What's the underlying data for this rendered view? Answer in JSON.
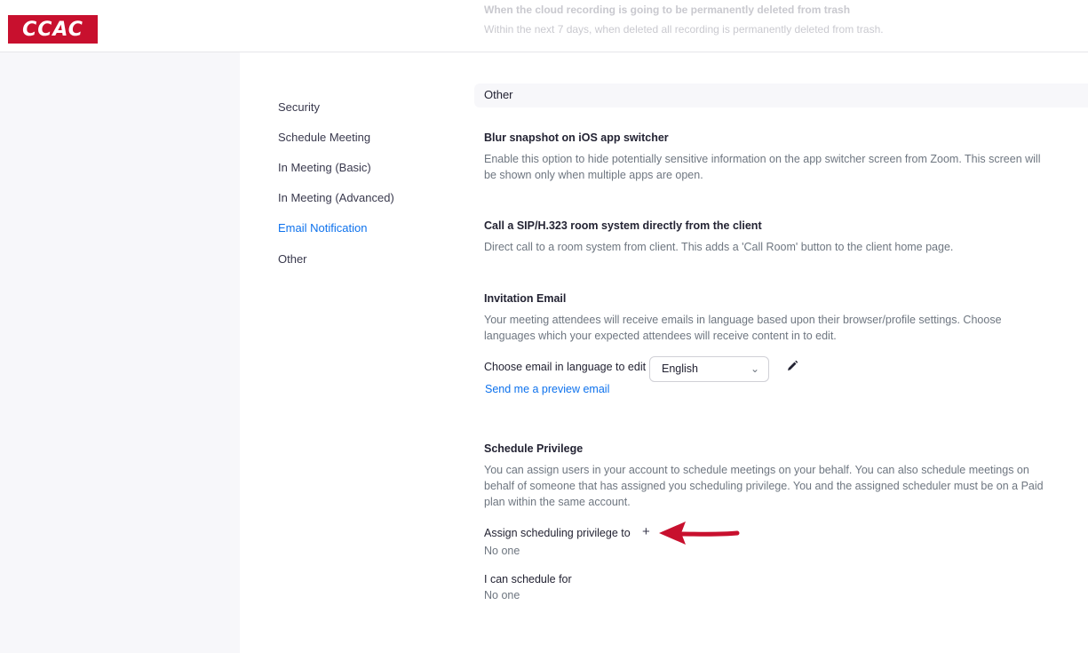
{
  "header": {
    "logo_text": "CCAC",
    "faded_title": "When the cloud recording is going to be permanently deleted from trash",
    "faded_desc": "Within the next 7 days, when deleted all recording is permanently deleted from trash."
  },
  "nav": {
    "items": [
      {
        "label": "Security",
        "active": false
      },
      {
        "label": "Schedule Meeting",
        "active": false
      },
      {
        "label": "In Meeting (Basic)",
        "active": false
      },
      {
        "label": "In Meeting (Advanced)",
        "active": false
      },
      {
        "label": "Email Notification",
        "active": true
      },
      {
        "label": "Other",
        "active": false
      }
    ]
  },
  "section": {
    "header": "Other",
    "blur": {
      "title": "Blur snapshot on iOS app switcher",
      "desc_line1": "Enable this option to hide potentially sensitive information on the app switcher screen from Zoom. This screen will",
      "desc_line2": "be shown only when multiple apps are open."
    },
    "sip": {
      "title": "Call a SIP/H.323 room system directly from the client",
      "desc": "Direct call to a room system from client. This adds a 'Call Room' button to the client home page."
    },
    "invitation": {
      "title": "Invitation Email",
      "desc_line1": "Your meeting attendees will receive emails in language based upon their browser/profile settings. Choose",
      "desc_line2": "languages which your expected attendees will receive content in to edit.",
      "choose_label": "Choose email in language to edit",
      "language_selected": "English",
      "preview_link": "Send me a preview email"
    },
    "schedule": {
      "title": "Schedule Privilege",
      "desc_line1": "You can assign users in your account to schedule meetings on your behalf. You can also schedule meetings on",
      "desc_line2": "behalf of someone that has assigned you scheduling privilege. You and the assigned scheduler must be on a Paid",
      "desc_line3": "plan within the same account.",
      "assign_label": "Assign scheduling privilege to",
      "assign_plus": "+",
      "assign_value": "No one",
      "can_schedule_label": "I can schedule for",
      "can_schedule_value": "No one"
    }
  },
  "colors": {
    "accent": "#0e72ed",
    "logo_red": "#c8102e",
    "arrow_red": "#c8102e"
  }
}
